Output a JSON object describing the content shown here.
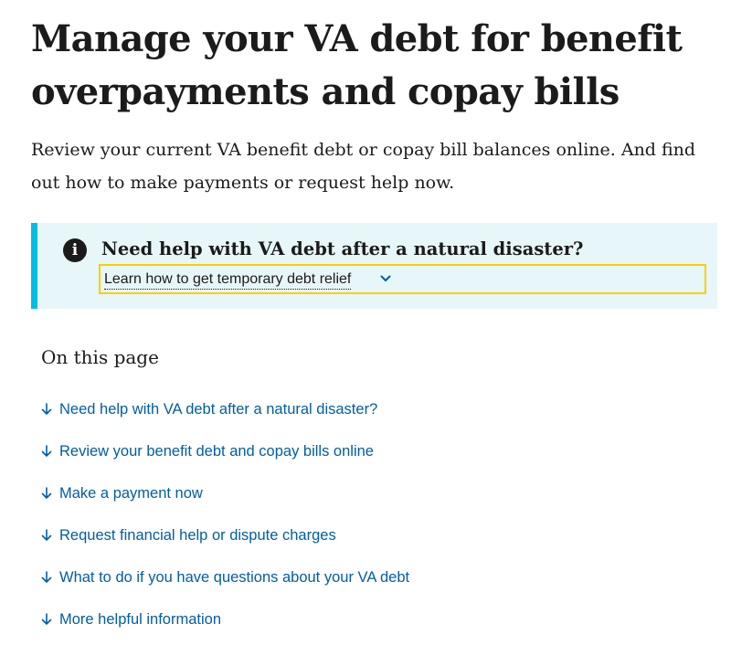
{
  "page": {
    "title": "Manage your VA debt for benefit overpayments and copay bills",
    "intro": "Review your current VA benefit debt or copay bill balances online. And find out how to make payments or request help now."
  },
  "alert": {
    "icon": "info-icon",
    "icon_glyph": "i",
    "heading": "Need help with VA debt after a natural disaster?",
    "expander_label": "Learn how to get temporary debt relief",
    "expander_icon": "chevron-down-icon",
    "border_color": "#00bde3",
    "background_color": "#e7f6f8",
    "focus_color": "#face00"
  },
  "toc": {
    "title": "On this page",
    "link_color": "#005ea2",
    "link_icon": "arrow-down-icon",
    "items": [
      {
        "label": "Need help with VA debt after a natural disaster?"
      },
      {
        "label": "Review your benefit debt and copay bills online"
      },
      {
        "label": "Make a payment now"
      },
      {
        "label": "Request financial help or dispute charges"
      },
      {
        "label": "What to do if you have questions about your VA debt"
      },
      {
        "label": "More helpful information"
      }
    ]
  }
}
